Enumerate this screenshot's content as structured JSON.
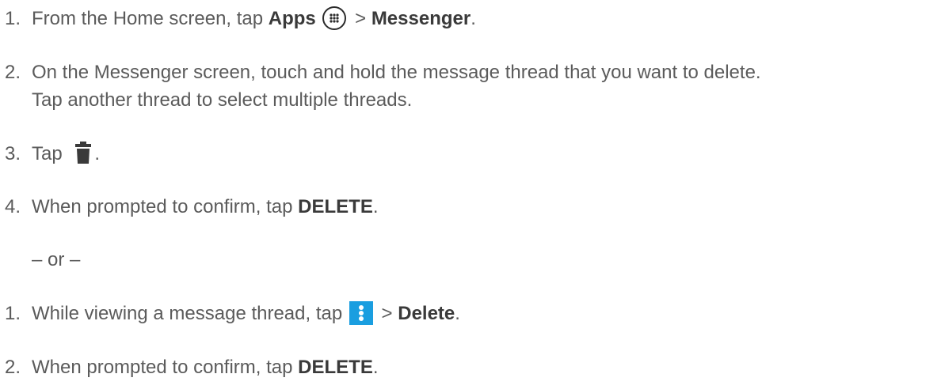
{
  "steps_a": [
    {
      "num": "1.",
      "pre": "From the Home screen, tap ",
      "b1": "Apps",
      "sep": " > ",
      "b2": "Messenger",
      "post": ".",
      "icon": "apps-icon"
    },
    {
      "num": "2.",
      "line1": "On the Messenger screen, touch and hold the message thread that you want to delete.",
      "line2": "Tap another thread to select multiple threads."
    },
    {
      "num": "3.",
      "pre": "Tap",
      "post": ".",
      "icon": "trash-icon"
    },
    {
      "num": "4.",
      "pre": "When prompted to confirm, tap ",
      "b1": "DELETE",
      "post": "."
    }
  ],
  "separator": "– or –",
  "steps_b": [
    {
      "num": "1.",
      "pre": "While viewing a message thread, tap ",
      "sep": " > ",
      "b1": "Delete",
      "post": ".",
      "icon": "more-vertical-menu-icon",
      "icon_color": "#1a9ee0"
    },
    {
      "num": "2.",
      "pre": "When prompted to confirm, tap ",
      "b1": "DELETE",
      "post": "."
    }
  ]
}
